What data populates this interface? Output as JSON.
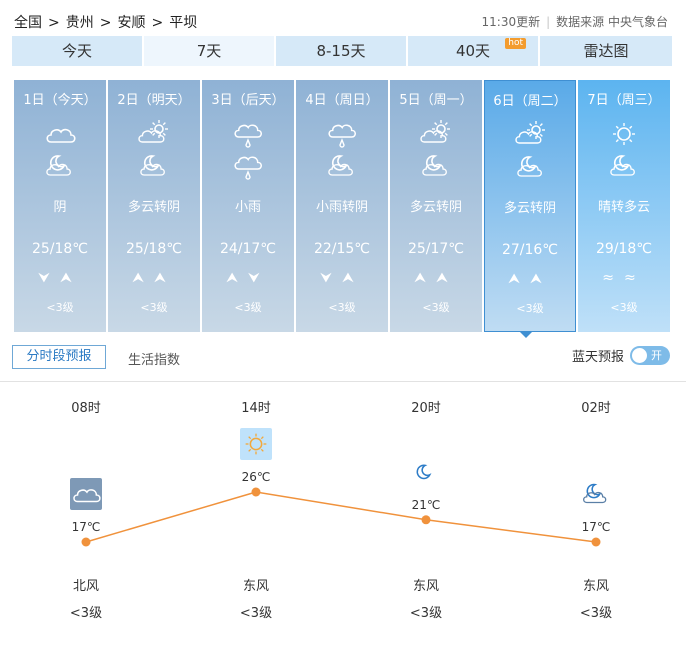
{
  "breadcrumb": [
    "全国",
    "贵州",
    "安顺",
    "平坝"
  ],
  "breadcrumb_sep": ">",
  "meta": {
    "update": "11:30更新",
    "source": "数据来源 中央气象台"
  },
  "tabs": [
    {
      "label": "今天"
    },
    {
      "label": "7天"
    },
    {
      "label": "8-15天"
    },
    {
      "label": "40天",
      "badge": "hot"
    },
    {
      "label": "雷达图"
    }
  ],
  "days": [
    {
      "date": "1日（今天）",
      "icon_day": "cloudy-icon",
      "icon_night": "partly-cloudy-night-icon",
      "desc": "阴",
      "temp": "25/18℃",
      "wind": "⮟⮝",
      "level": "<3级"
    },
    {
      "date": "2日（明天）",
      "icon_day": "partly-cloudy-icon",
      "icon_night": "partly-cloudy-night-icon",
      "desc": "多云转阴",
      "temp": "25/18℃",
      "wind": "⮝⮝",
      "level": "<3级"
    },
    {
      "date": "3日（后天）",
      "icon_day": "light-rain-icon",
      "icon_night": "light-rain-icon",
      "desc": "小雨",
      "temp": "24/17℃",
      "wind": "⮝⮟",
      "level": "<3级"
    },
    {
      "date": "4日（周日）",
      "icon_day": "light-rain-icon",
      "icon_night": "partly-cloudy-night-icon",
      "desc": "小雨转阴",
      "temp": "22/15℃",
      "wind": "⮟⮝",
      "level": "<3级"
    },
    {
      "date": "5日（周一）",
      "icon_day": "partly-cloudy-icon",
      "icon_night": "partly-cloudy-night-icon",
      "desc": "多云转阴",
      "temp": "25/17℃",
      "wind": "⮝⮝",
      "level": "<3级"
    },
    {
      "date": "6日（周二）",
      "icon_day": "partly-cloudy-icon",
      "icon_night": "partly-cloudy-night-icon",
      "desc": "多云转阴",
      "temp": "27/16℃",
      "wind": "⮝⮝",
      "level": "<3级"
    },
    {
      "date": "7日（周三）",
      "icon_day": "sunny-icon",
      "icon_night": "partly-cloudy-night-icon",
      "desc": "晴转多云",
      "temp": "29/18℃",
      "wind": "≈≈",
      "level": "<3级"
    }
  ],
  "selected_day": 5,
  "subtabs": {
    "hourly": "分时段预报",
    "life": "生活指数"
  },
  "bluesky": {
    "label": "蓝天预报",
    "toggle": "开"
  },
  "hourly": [
    {
      "time": "08时",
      "icon": "cloudy-icon",
      "temp": "17℃",
      "wind": "北风",
      "level": "<3级"
    },
    {
      "time": "14时",
      "icon": "sunny-icon",
      "temp": "26℃",
      "wind": "东风",
      "level": "<3级"
    },
    {
      "time": "20时",
      "icon": "clear-night-icon",
      "temp": "21℃",
      "wind": "东风",
      "level": "<3级"
    },
    {
      "time": "02时",
      "icon": "partly-cloudy-night-icon",
      "temp": "17℃",
      "wind": "东风",
      "level": "<3级"
    }
  ],
  "chart_data": {
    "type": "line",
    "x": [
      "08时",
      "14时",
      "20时",
      "02时"
    ],
    "values": [
      17,
      26,
      21,
      17
    ],
    "unit": "℃",
    "line_color": "#f0923c"
  }
}
